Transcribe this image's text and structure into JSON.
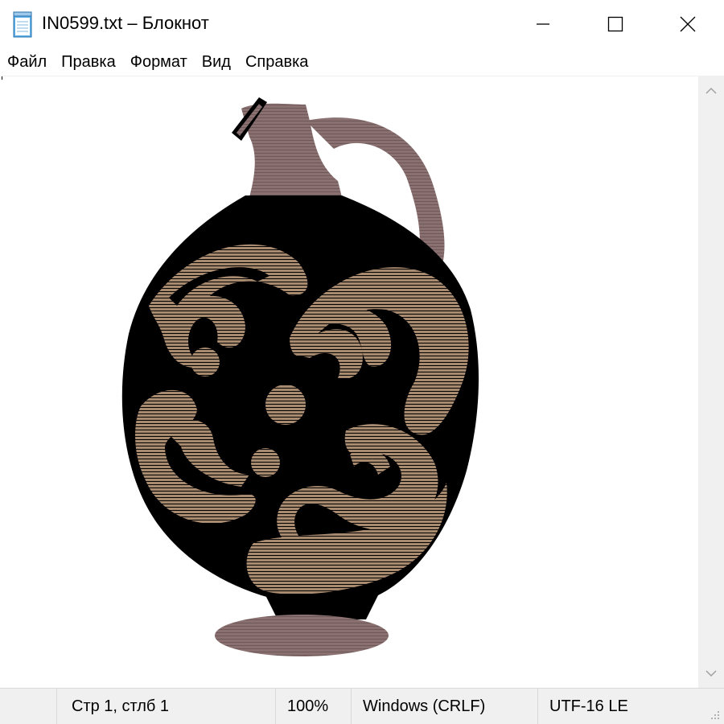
{
  "window": {
    "title": "IN0599.txt – Блокнот",
    "icon": "notepad-icon"
  },
  "window_controls": {
    "minimize_icon": "minimize-icon",
    "maximize_icon": "maximize-icon",
    "close_icon": "close-icon"
  },
  "menu": {
    "items": [
      {
        "label": "Файл"
      },
      {
        "label": "Правка"
      },
      {
        "label": "Формат"
      },
      {
        "label": "Вид"
      },
      {
        "label": "Справка"
      }
    ]
  },
  "editor": {
    "content": "ASCII-art image of an ancient jug with swirling decorative pattern",
    "colors": {
      "body": "#000000",
      "neck_and_handle": "#8a7070",
      "decor": "#a88a6e",
      "foot": "#8a7070"
    }
  },
  "status": {
    "position": "Стр 1, стлб 1",
    "zoom": "100%",
    "line_endings": "Windows (CRLF)",
    "encoding": "UTF-16 LE"
  },
  "colors": {
    "chrome_bg": "#f0f0f0",
    "divider": "#d9d9d9",
    "text": "#000000"
  }
}
